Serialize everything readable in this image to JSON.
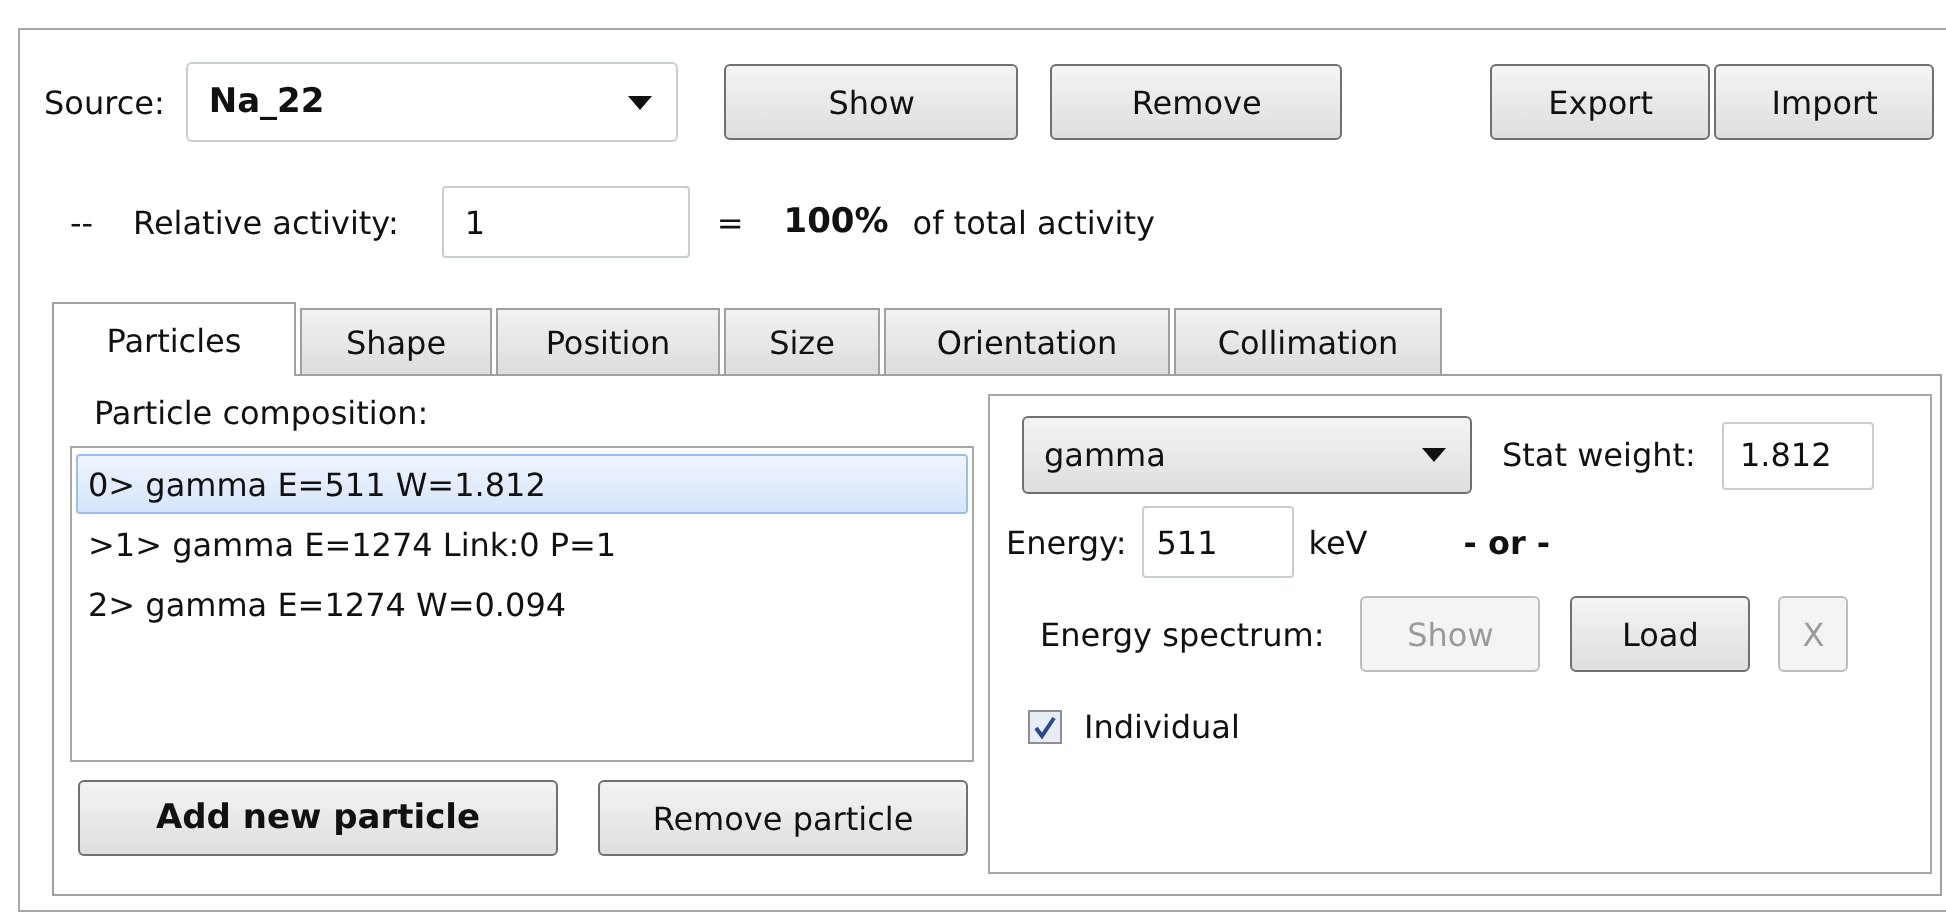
{
  "source": {
    "label": "Source:",
    "value": "Na_22"
  },
  "source_buttons": [
    {
      "label": "Show"
    },
    {
      "label": "Remove"
    }
  ],
  "file_buttons": [
    {
      "label": "Export"
    },
    {
      "label": "Import"
    }
  ],
  "activity": {
    "prefix": "--",
    "label": "Relative activity:",
    "value": "1",
    "equals": "=",
    "percent": "100%",
    "suffix": "of total activity"
  },
  "tabs": [
    {
      "label": "Particles",
      "selected": true
    },
    {
      "label": "Shape",
      "selected": false
    },
    {
      "label": "Position",
      "selected": false
    },
    {
      "label": "Size",
      "selected": false
    },
    {
      "label": "Orientation",
      "selected": false
    },
    {
      "label": "Collimation",
      "selected": false
    }
  ],
  "particles": {
    "label": "Particle composition:",
    "items": [
      {
        "text": "0> gamma E=511 W=1.812",
        "selected": true
      },
      {
        "text": ">1> gamma E=1274 Link:0 P=1",
        "selected": false
      },
      {
        "text": "2> gamma E=1274 W=0.094",
        "selected": false
      }
    ],
    "buttons": [
      {
        "label": "Add new particle",
        "default": true
      },
      {
        "label": "Remove particle",
        "default": false
      }
    ]
  },
  "particle_editor": {
    "type": "gamma",
    "stat_weight_label": "Stat weight:",
    "stat_weight": "1.812",
    "energy_label": "Energy:",
    "energy": "511",
    "unit": "keV",
    "or": "- or -",
    "spectrum_label": "Energy spectrum:",
    "spectrum_buttons": [
      {
        "label": "Show",
        "disabled": true
      },
      {
        "label": "Load",
        "disabled": false
      },
      {
        "label": "X",
        "disabled": true
      }
    ],
    "individual": {
      "label": "Individual",
      "checked": true
    }
  }
}
